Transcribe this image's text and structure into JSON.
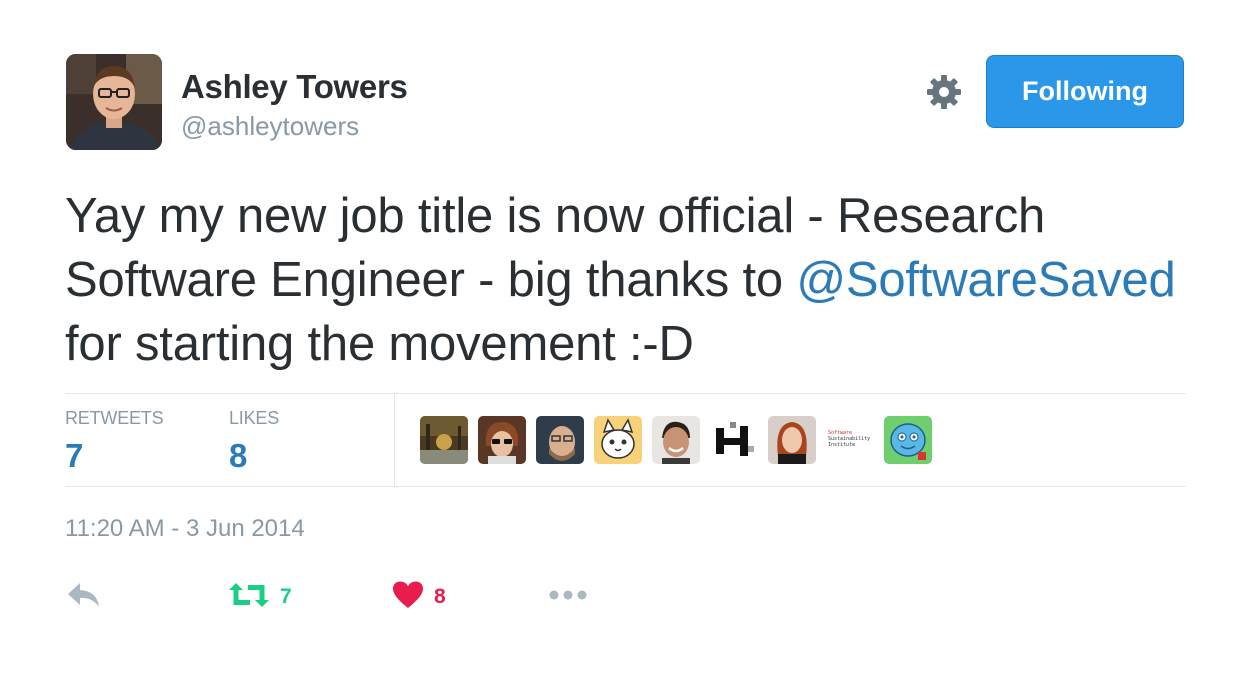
{
  "user": {
    "name": "Ashley Towers",
    "handle": "@ashleytowers"
  },
  "follow_button": {
    "label": "Following",
    "color": "#2b97e8"
  },
  "tweet": {
    "text_before": "Yay my new job title is now official - Research Software Engineer - big thanks to ",
    "mention": "@SoftwareSaved",
    "text_after": " for starting the movement :-D",
    "timestamp": "11:20 AM - 3 Jun 2014"
  },
  "stats": {
    "retweets_label": "RETWEETS",
    "retweets_count": "7",
    "likes_label": "LIKES",
    "likes_count": "8"
  },
  "likers": [
    {
      "icon": "liker-avatar-landscape"
    },
    {
      "icon": "liker-avatar-person-glasses"
    },
    {
      "icon": "liker-avatar-person-bearded"
    },
    {
      "icon": "liker-avatar-cartoon-cat"
    },
    {
      "icon": "liker-avatar-person-smiling"
    },
    {
      "icon": "liker-avatar-black-white-pattern"
    },
    {
      "icon": "liker-avatar-person-redhead"
    },
    {
      "icon": "liker-avatar-ssi-logo",
      "logo_text": [
        "Software",
        "Sustainability",
        "Institute"
      ]
    },
    {
      "icon": "liker-avatar-cartoon-creature"
    }
  ],
  "actions": {
    "reply_icon": "reply-icon",
    "retweet_icon": "retweet-icon",
    "retweet_count": "7",
    "like_icon": "heart-icon",
    "like_count": "8",
    "more_icon": "more-icon"
  },
  "colors": {
    "link": "#2b7bb9",
    "retweet": "#19cf86",
    "like": "#e81c4f",
    "muted": "#8899a6",
    "text": "#292f33"
  }
}
